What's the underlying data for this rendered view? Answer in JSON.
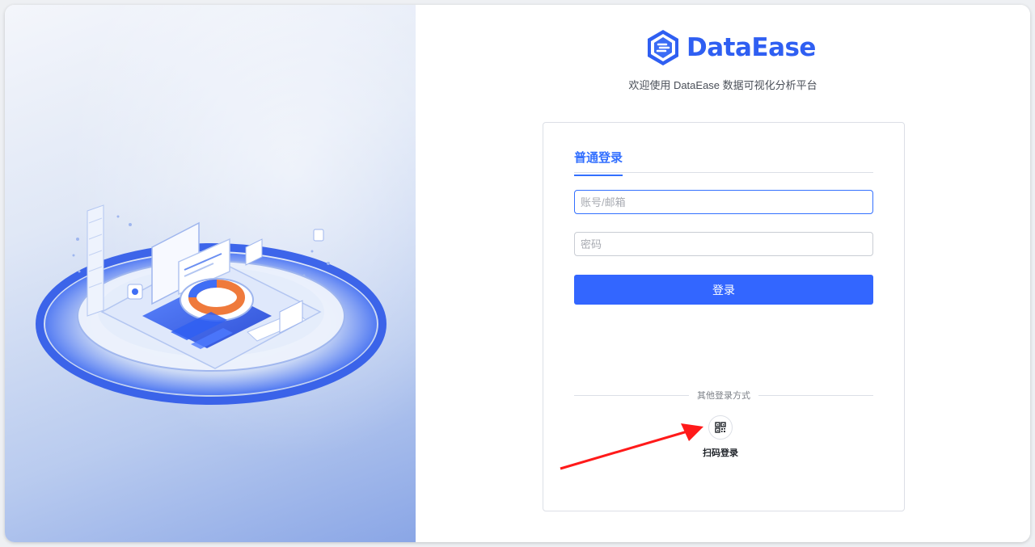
{
  "brand": {
    "name": "DataEase",
    "welcome": "欢迎使用 DataEase 数据可视化分析平台",
    "logo_icon": "dataease-hexagon-logo",
    "accent_color": "#3370ff"
  },
  "login": {
    "tab_label": "普通登录",
    "account_placeholder": "账号/邮箱",
    "password_placeholder": "密码",
    "submit_label": "登录",
    "other_methods_label": "其他登录方式",
    "qr_icon": "qrcode-icon",
    "qr_label": "扫码登录"
  },
  "annotation": {
    "arrow_color": "#ff1a1a"
  }
}
